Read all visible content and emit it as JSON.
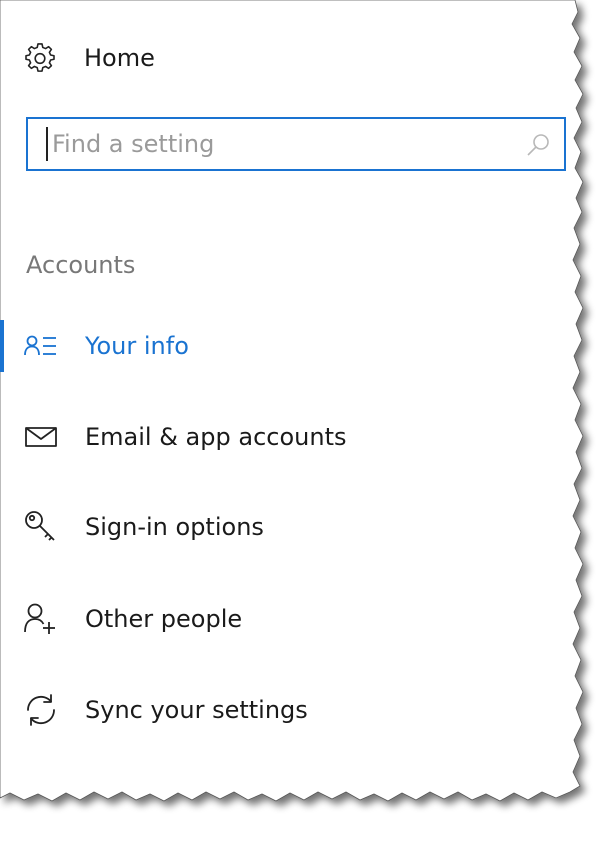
{
  "home": {
    "label": "Home",
    "icon": "gear-icon"
  },
  "search": {
    "placeholder": "Find a setting",
    "value": "",
    "icon": "search-icon"
  },
  "section": {
    "heading": "Accounts"
  },
  "nav": {
    "items": [
      {
        "label": "Your info",
        "icon": "your-info-icon",
        "selected": true
      },
      {
        "label": "Email & app accounts",
        "icon": "mail-icon",
        "selected": false
      },
      {
        "label": "Sign-in options",
        "icon": "key-icon",
        "selected": false
      },
      {
        "label": "Other people",
        "icon": "person-add-icon",
        "selected": false
      },
      {
        "label": "Sync your settings",
        "icon": "sync-icon",
        "selected": false
      }
    ]
  },
  "colors": {
    "accent": "#1a73d1",
    "text": "#1a1a1a",
    "muted": "#787878",
    "placeholder": "#9a9a9a"
  }
}
